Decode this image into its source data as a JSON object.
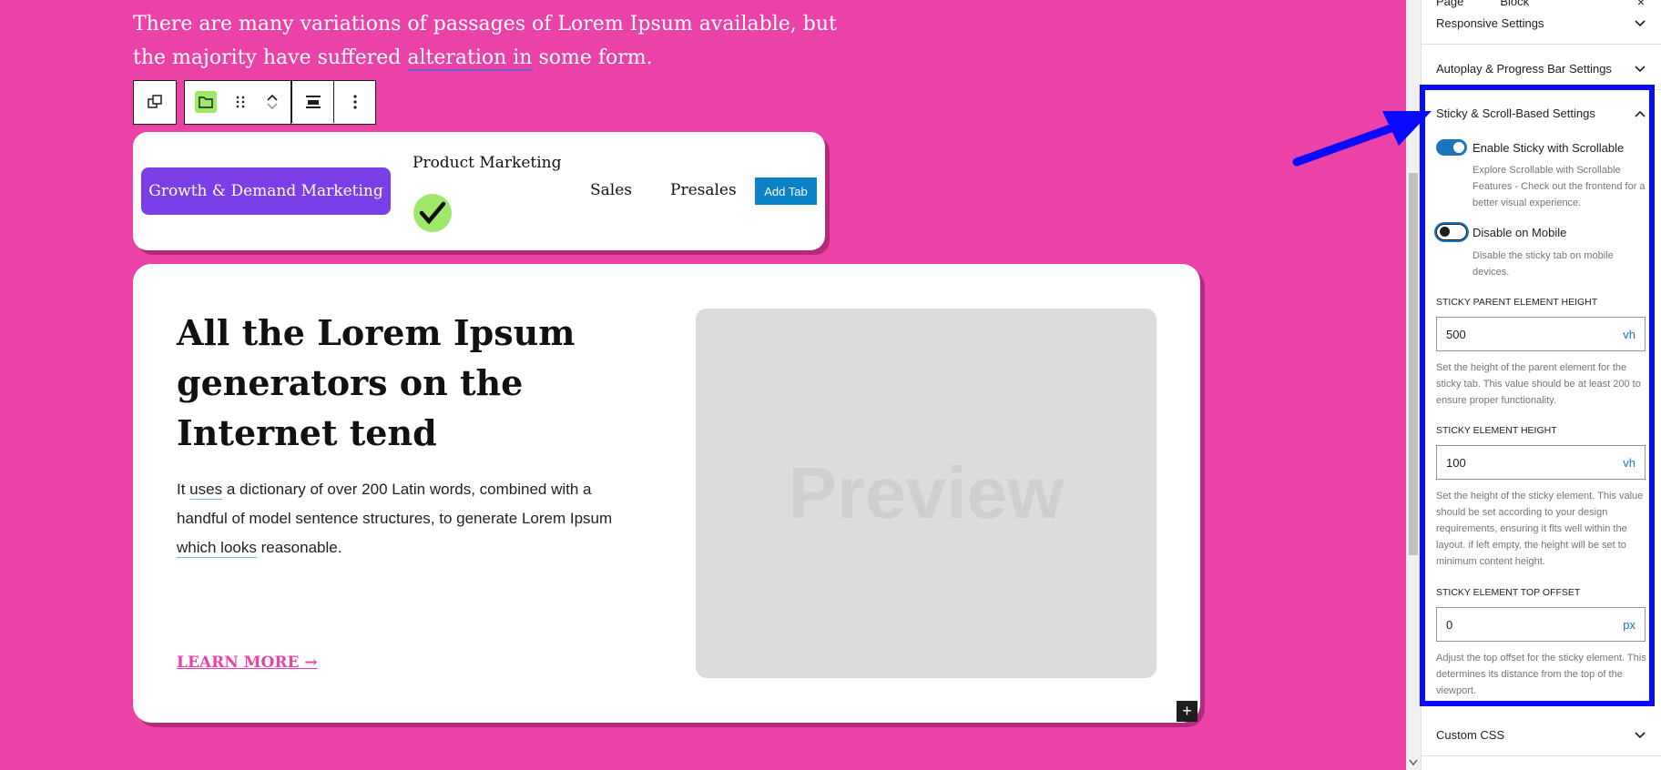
{
  "canvas": {
    "intro_1": "There are many variations of passages of Lorem Ipsum available, but the majority have suffered ",
    "intro_ul": "alteration in",
    "intro_2": " some form.",
    "tabs": {
      "active": "Growth & Demand Marketing",
      "product": "Product Marketing",
      "sales": "Sales",
      "presales": "Presales",
      "add_tab": "Add Tab"
    },
    "headline": "All the Lorem Ipsum generators on the Internet tend",
    "body_1": "It ",
    "body_ul1": "uses",
    "body_2": " a dictionary of over 200 Latin words, combined with a handful of model sentence structures, to generate Lorem Ipsum ",
    "body_ul2": "which looks",
    "body_3": " reasonable.",
    "learn_more": "LEARN MORE →",
    "preview": "Preview",
    "plus": "+"
  },
  "sidebar": {
    "tab_page": "Page",
    "tab_block": "Block",
    "close": "×",
    "responsive": "Responsive Settings",
    "autoplay": "Autoplay & Progress Bar Settings",
    "sticky": "Sticky & Scroll-Based Settings",
    "enable_sticky": "Enable Sticky with Scrollable",
    "enable_sticky_help": "Explore Scrollable with Scrollable Features - Check out the frontend for a better visual experience.",
    "disable_mobile": "Disable on Mobile",
    "disable_mobile_help": "Disable the sticky tab on mobile devices.",
    "parent_height_label": "STICKY PARENT ELEMENT HEIGHT",
    "parent_height_value": "500",
    "parent_height_unit": "vh",
    "parent_height_help": "Set the height of the parent element for the sticky tab. This value should be at least 200 to ensure proper functionality.",
    "element_height_label": "STICKY ELEMENT HEIGHT",
    "element_height_value": "100",
    "element_height_unit": "vh",
    "element_height_help": "Set the height of the sticky element. This value should be set according to your design requirements, ensuring it fits well within the layout. if left empty, the height will be set to minimum content height.",
    "top_offset_label": "STICKY ELEMENT TOP OFFSET",
    "top_offset_value": "0",
    "top_offset_unit": "px",
    "top_offset_help": "Adjust the top offset for the sticky element. This determines its distance from the top of the viewport.",
    "custom_css": "Custom CSS"
  },
  "colors": {
    "canvas_bg": "#ea42a6",
    "accent_purple": "#7a3fe6",
    "check_green": "#9ee86a",
    "wp_blue": "#1b75bc",
    "highlight_blue": "#0a0aff"
  },
  "toggles": {
    "enable_sticky": true,
    "disable_mobile": false
  }
}
